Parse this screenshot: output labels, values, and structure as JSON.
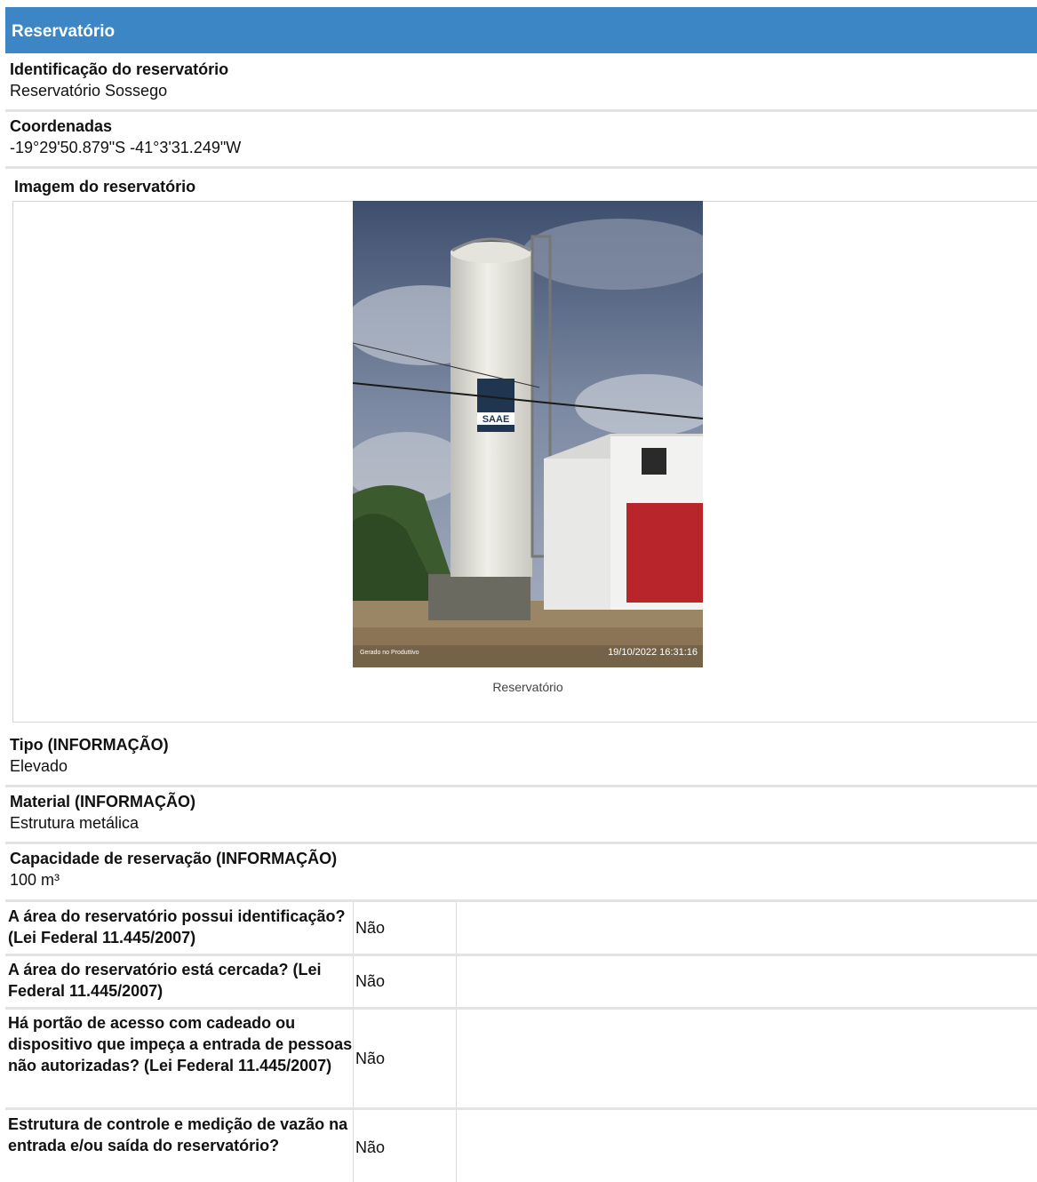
{
  "section": {
    "title": "Reservatório"
  },
  "fields": {
    "identification": {
      "label": "Identificação do reservatório",
      "value": "Reservatório Sossego"
    },
    "coordinates": {
      "label": "Coordenadas",
      "value": "-19°29'50.879\"S -41°3'31.249\"W"
    },
    "image": {
      "label": "Imagem do reservatório",
      "caption": "Reservatório",
      "watermark_left": "Gerado no Produttivo",
      "timestamp": "19/10/2022 16:31:16",
      "logo_text": "SAAE"
    },
    "type": {
      "label": "Tipo (INFORMAÇÃO)",
      "value": "Elevado"
    },
    "material": {
      "label": "Material (INFORMAÇÃO)",
      "value": "Estrutura metálica"
    },
    "capacity": {
      "label": "Capacidade de reservação (INFORMAÇÃO)",
      "value": "100 m³"
    }
  },
  "questions": [
    {
      "question": "A área do reservatório possui identificação? (Lei Federal 11.445/2007)",
      "answer": "Não"
    },
    {
      "question": "A área do reservatório está cercada? (Lei Federal 11.445/2007)",
      "answer": "Não"
    },
    {
      "question": "Há portão de acesso com cadeado ou dispositivo que impeça a entrada de pessoas não autorizadas? (Lei Federal 11.445/2007)",
      "answer": "Não"
    },
    {
      "question": "Estrutura de controle e medição de vazão na entrada e/ou saída do reservatório?",
      "answer": "Não"
    }
  ]
}
